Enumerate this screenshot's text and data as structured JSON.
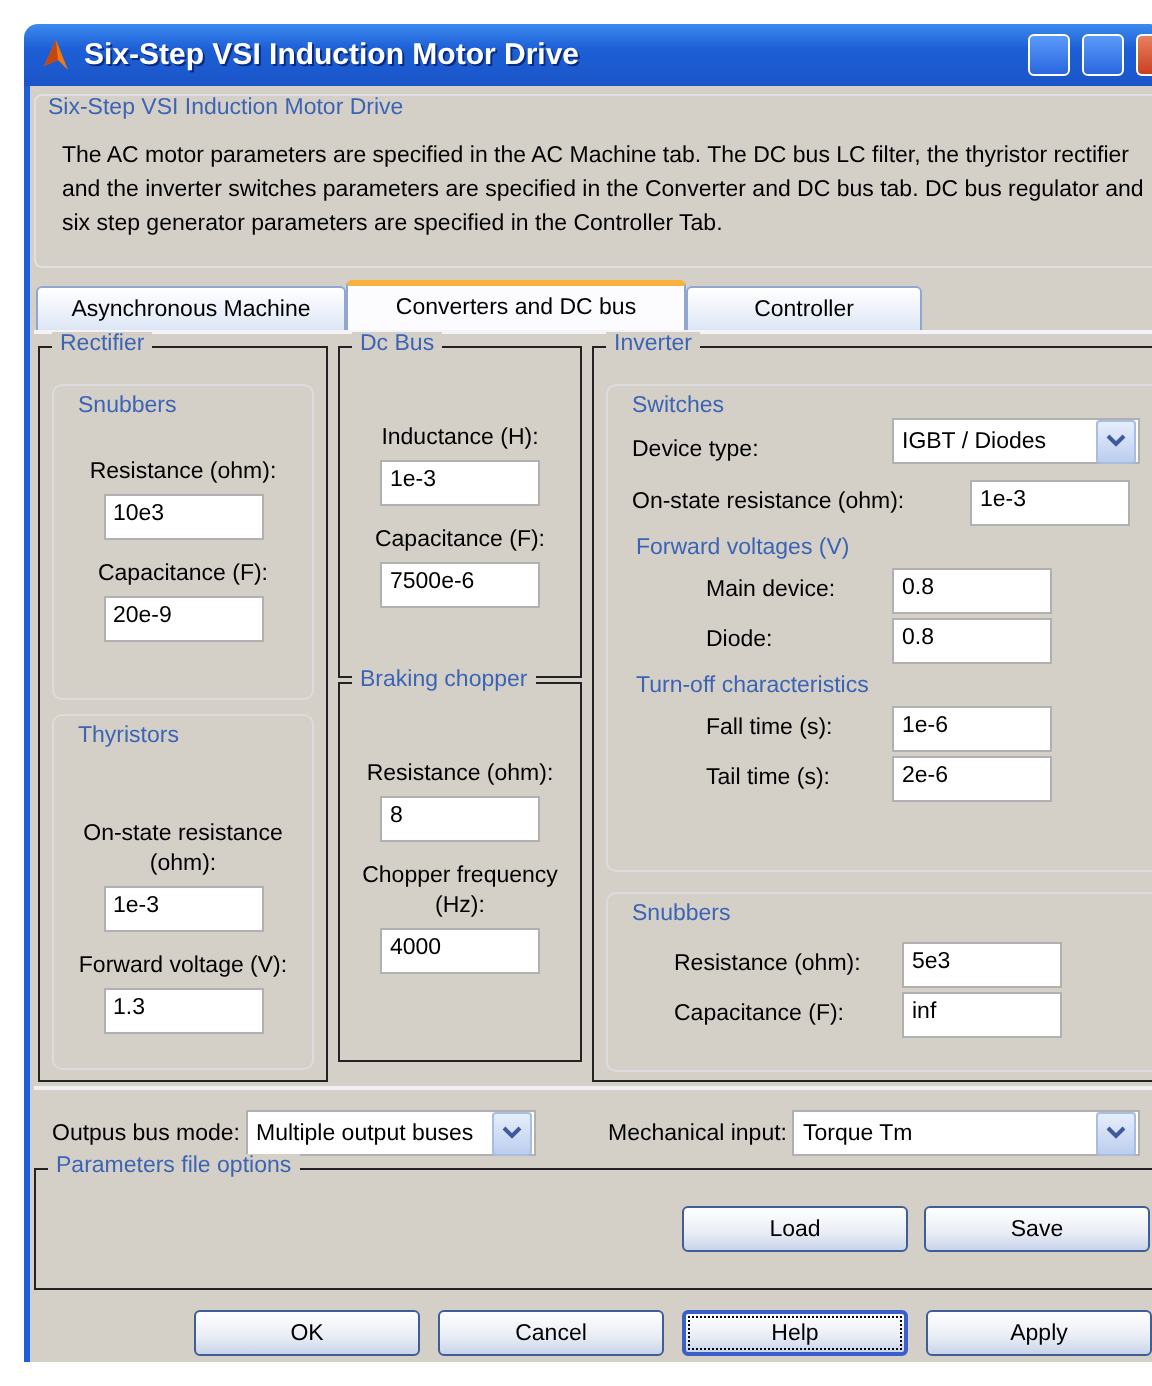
{
  "window": {
    "title": "Six-Step VSI Induction Motor Drive"
  },
  "description": {
    "title": "Six-Step VSI Induction Motor Drive",
    "text": "The AC motor parameters are specified in the AC Machine tab. The DC bus LC filter, the thyristor rectifier and the inverter switches parameters are specified in the Converter and DC bus tab. DC bus regulator and six step generator parameters are specified in the Controller Tab."
  },
  "tabs": [
    {
      "label": "Asynchronous Machine",
      "selected": false
    },
    {
      "label": "Converters and DC bus",
      "selected": true
    },
    {
      "label": "Controller",
      "selected": false
    }
  ],
  "rectifier": {
    "title": "Rectifier",
    "groups": [
      {
        "title": "Snubbers",
        "fields": [
          {
            "label": "Resistance (ohm):",
            "value": "10e3"
          },
          {
            "label": "Capacitance (F):",
            "value": "20e-9"
          }
        ]
      },
      {
        "title": "Thyristors",
        "fields": [
          {
            "label": "On-state resistance (ohm):",
            "value": "1e-3"
          },
          {
            "label": "Forward voltage (V):",
            "value": "1.3"
          }
        ]
      }
    ]
  },
  "dc_bus": {
    "title": "Dc Bus",
    "fields": [
      {
        "label": "Inductance (H):",
        "value": "1e-3"
      },
      {
        "label": "Capacitance (F):",
        "value": "7500e-6"
      }
    ]
  },
  "braking_chopper": {
    "title": "Braking chopper",
    "fields": [
      {
        "label": "Resistance (ohm):",
        "value": "8"
      },
      {
        "label": "Chopper frequency (Hz):",
        "value": "4000"
      }
    ]
  },
  "inverter": {
    "title": "Inverter",
    "switches": {
      "title": "Switches",
      "device_type": {
        "label": "Device type:",
        "value": "IGBT / Diodes"
      },
      "on_state": {
        "label": "On-state resistance (ohm):",
        "value": "1e-3"
      },
      "sections": [
        {
          "title": "Forward voltages (V)",
          "fields": [
            {
              "label": "Main device:",
              "value": "0.8"
            },
            {
              "label": "Diode:",
              "value": "0.8"
            }
          ]
        },
        {
          "title": "Turn-off characteristics",
          "fields": [
            {
              "label": "Fall time (s):",
              "value": "1e-6"
            },
            {
              "label": "Tail time (s):",
              "value": "2e-6"
            }
          ]
        }
      ]
    },
    "snubbers": {
      "title": "Snubbers",
      "fields": [
        {
          "label": "Resistance (ohm):",
          "value": "5e3"
        },
        {
          "label": "Capacitance (F):",
          "value": "inf"
        }
      ]
    }
  },
  "output_bus_mode": {
    "label": "Outpus bus mode:",
    "value": "Multiple output buses"
  },
  "mechanical_input": {
    "label": "Mechanical input:",
    "value": "Torque Tm"
  },
  "parameters_file": {
    "title": "Parameters file options",
    "buttons": [
      "Load",
      "Save"
    ]
  },
  "buttons": [
    {
      "label": "OK",
      "focused": false
    },
    {
      "label": "Cancel",
      "focused": false
    },
    {
      "label": "Help",
      "focused": true
    },
    {
      "label": "Apply",
      "focused": false
    }
  ]
}
